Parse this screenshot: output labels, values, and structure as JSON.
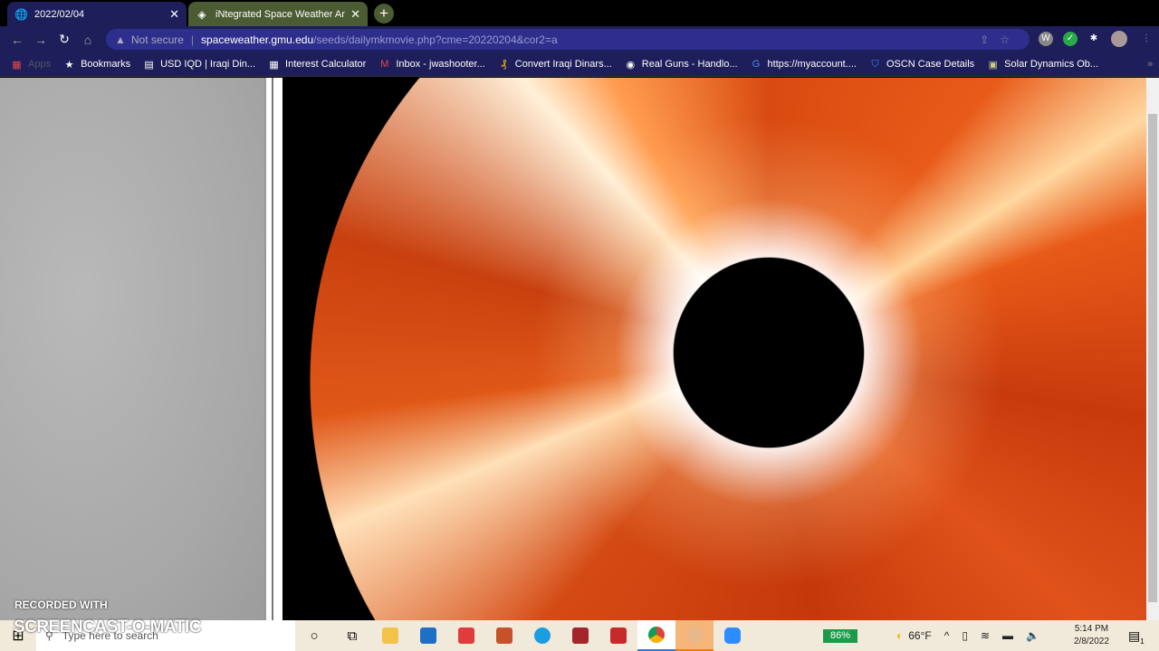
{
  "tabs": [
    {
      "label": "2022/02/04",
      "icon": "globe-icon"
    },
    {
      "label": "iNtegrated Space Weather Analy",
      "icon": "isw-icon"
    }
  ],
  "address": {
    "security": "Not secure",
    "host": "spaceweather.gmu.edu",
    "path": "/seeds/dailymkmovie.php?cme=20220204&cor2=a"
  },
  "bookmarks": [
    {
      "label": "Apps",
      "icon": "▦"
    },
    {
      "label": "Bookmarks",
      "icon": "★"
    },
    {
      "label": "USD IQD | Iraqi Din...",
      "icon": "▤"
    },
    {
      "label": "Interest Calculator",
      "icon": "▦"
    },
    {
      "label": "Inbox - jwashooter...",
      "icon": "M"
    },
    {
      "label": "Convert Iraqi Dinars...",
      "icon": "₰"
    },
    {
      "label": "Real Guns - Handlo...",
      "icon": "◉"
    },
    {
      "label": "https://myaccount....",
      "icon": "G"
    },
    {
      "label": "OSCN Case Details",
      "icon": "⛉"
    },
    {
      "label": "Solar Dynamics Ob...",
      "icon": "▣"
    }
  ],
  "watermark": {
    "line1": "RECORDED WITH",
    "line2": "SCREENCAST-O-MATIC"
  },
  "taskbar": {
    "search_placeholder": "Type here to search",
    "battery": "86%",
    "weather": "66°F",
    "time": "5:14 PM",
    "date": "2/8/2022",
    "notifications": "1"
  }
}
